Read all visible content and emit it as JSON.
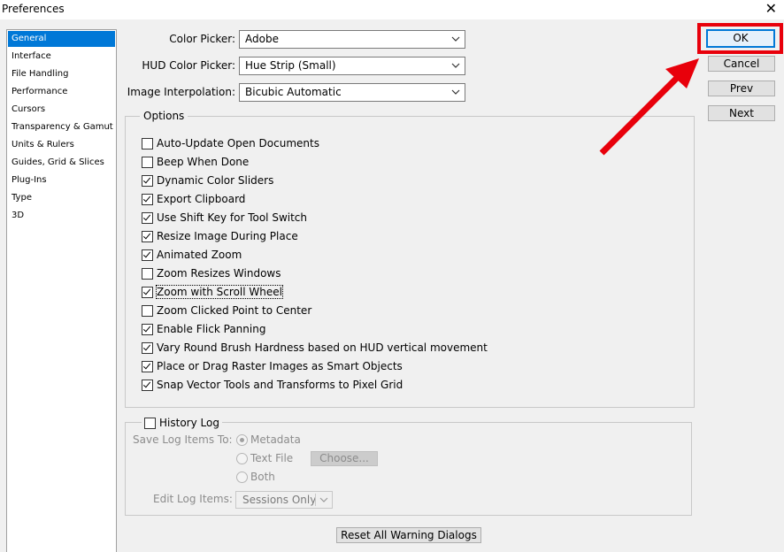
{
  "window": {
    "title": "Preferences",
    "close_glyph": "✕"
  },
  "sidebar": {
    "items": [
      {
        "label": "General",
        "selected": true
      },
      {
        "label": "Interface"
      },
      {
        "label": "File Handling"
      },
      {
        "label": "Performance"
      },
      {
        "label": "Cursors"
      },
      {
        "label": "Transparency & Gamut"
      },
      {
        "label": "Units & Rulers"
      },
      {
        "label": "Guides, Grid & Slices"
      },
      {
        "label": "Plug-Ins"
      },
      {
        "label": "Type"
      },
      {
        "label": "3D"
      }
    ]
  },
  "fields": {
    "color_picker": {
      "label": "Color Picker:",
      "value": "Adobe"
    },
    "hud_color_picker": {
      "label": "HUD Color Picker:",
      "value": "Hue Strip (Small)"
    },
    "image_interpolation": {
      "label": "Image Interpolation:",
      "value": "Bicubic Automatic"
    }
  },
  "options": {
    "title": "Options",
    "items": [
      {
        "label": "Auto-Update Open Documents",
        "checked": false
      },
      {
        "label": "Beep When Done",
        "checked": false
      },
      {
        "label": "Dynamic Color Sliders",
        "checked": true
      },
      {
        "label": "Export Clipboard",
        "checked": true
      },
      {
        "label": "Use Shift Key for Tool Switch",
        "checked": true
      },
      {
        "label": "Resize Image During Place",
        "checked": true
      },
      {
        "label": "Animated Zoom",
        "checked": true
      },
      {
        "label": "Zoom Resizes Windows",
        "checked": false
      },
      {
        "label": "Zoom with Scroll Wheel",
        "checked": true,
        "focused": true
      },
      {
        "label": "Zoom Clicked Point to Center",
        "checked": false
      },
      {
        "label": "Enable Flick Panning",
        "checked": true
      },
      {
        "label": "Vary Round Brush Hardness based on HUD vertical movement",
        "checked": true
      },
      {
        "label": "Place or Drag Raster Images as Smart Objects",
        "checked": true
      },
      {
        "label": "Snap Vector Tools and Transforms to Pixel Grid",
        "checked": true
      }
    ]
  },
  "history_log": {
    "title": "History Log",
    "checked": false,
    "save_to_label": "Save Log Items To:",
    "radios": [
      {
        "label": "Metadata",
        "selected": true
      },
      {
        "label": "Text File",
        "selected": false
      },
      {
        "label": "Both",
        "selected": false
      }
    ],
    "choose_label": "Choose...",
    "edit_label": "Edit Log Items:",
    "edit_value": "Sessions Only"
  },
  "buttons": {
    "ok": "OK",
    "cancel": "Cancel",
    "prev": "Prev",
    "next": "Next",
    "reset_warnings": "Reset All Warning Dialogs"
  },
  "colors": {
    "selection": "#0078d7",
    "highlight": "#e8000b"
  }
}
